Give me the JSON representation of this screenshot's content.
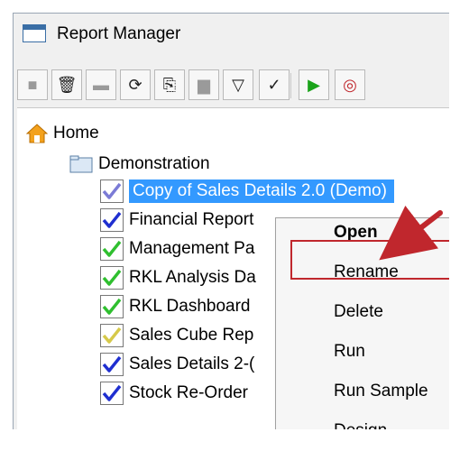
{
  "window": {
    "title": "Report Manager"
  },
  "toolbar": {
    "buttons": [
      {
        "name": "blank-square-icon",
        "glyph": "■",
        "dim": true
      },
      {
        "name": "trash-icon",
        "glyph": "🗑",
        "dim": false
      },
      {
        "name": "panel-icon",
        "glyph": "▬",
        "dim": true
      },
      {
        "name": "refresh-icon",
        "glyph": "⟳",
        "dim": false
      },
      {
        "name": "copy-icon",
        "glyph": "⎘",
        "dim": false
      },
      {
        "name": "stack-icon",
        "glyph": "▆",
        "dim": true
      },
      {
        "name": "filter-icon",
        "glyph": "▽",
        "dim": false
      },
      {
        "name": "check-icon",
        "glyph": "✓",
        "dim": false
      },
      {
        "name": "play-icon",
        "glyph": "▶",
        "dim": false
      },
      {
        "name": "record-icon",
        "glyph": "◎",
        "dim": false
      }
    ]
  },
  "tree": {
    "home": "Home",
    "folder": "Demonstration",
    "items": [
      {
        "label": "Copy of Sales Details 2.0 (Demo)",
        "check_color": "#7b7bd6",
        "selected": true
      },
      {
        "label": "Financial Report",
        "check_color": "#1f2fd0",
        "selected": false
      },
      {
        "label": "Management Pa",
        "check_color": "#2fbf2f",
        "selected": false
      },
      {
        "label": "RKL Analysis Da",
        "check_color": "#2fbf2f",
        "selected": false
      },
      {
        "label": "RKL Dashboard",
        "check_color": "#2fbf2f",
        "selected": false
      },
      {
        "label": "Sales Cube Rep",
        "check_color": "#d6c94a",
        "selected": false
      },
      {
        "label": "Sales Details 2-(",
        "check_color": "#1f2fd0",
        "selected": false
      },
      {
        "label": "Stock Re-Order",
        "check_color": "#1f2fd0",
        "selected": false
      }
    ]
  },
  "context_menu": {
    "items": [
      {
        "label": "Open",
        "bold": true
      },
      {
        "label": "Rename",
        "bold": false
      },
      {
        "label": "Delete",
        "bold": false
      },
      {
        "label": "Run",
        "bold": false
      },
      {
        "label": "Run Sample",
        "bold": false
      },
      {
        "label": "Design",
        "bold": false
      }
    ],
    "highlighted": "Rename"
  },
  "colors": {
    "selection": "#3399ff",
    "annotation": "#c0272d"
  }
}
